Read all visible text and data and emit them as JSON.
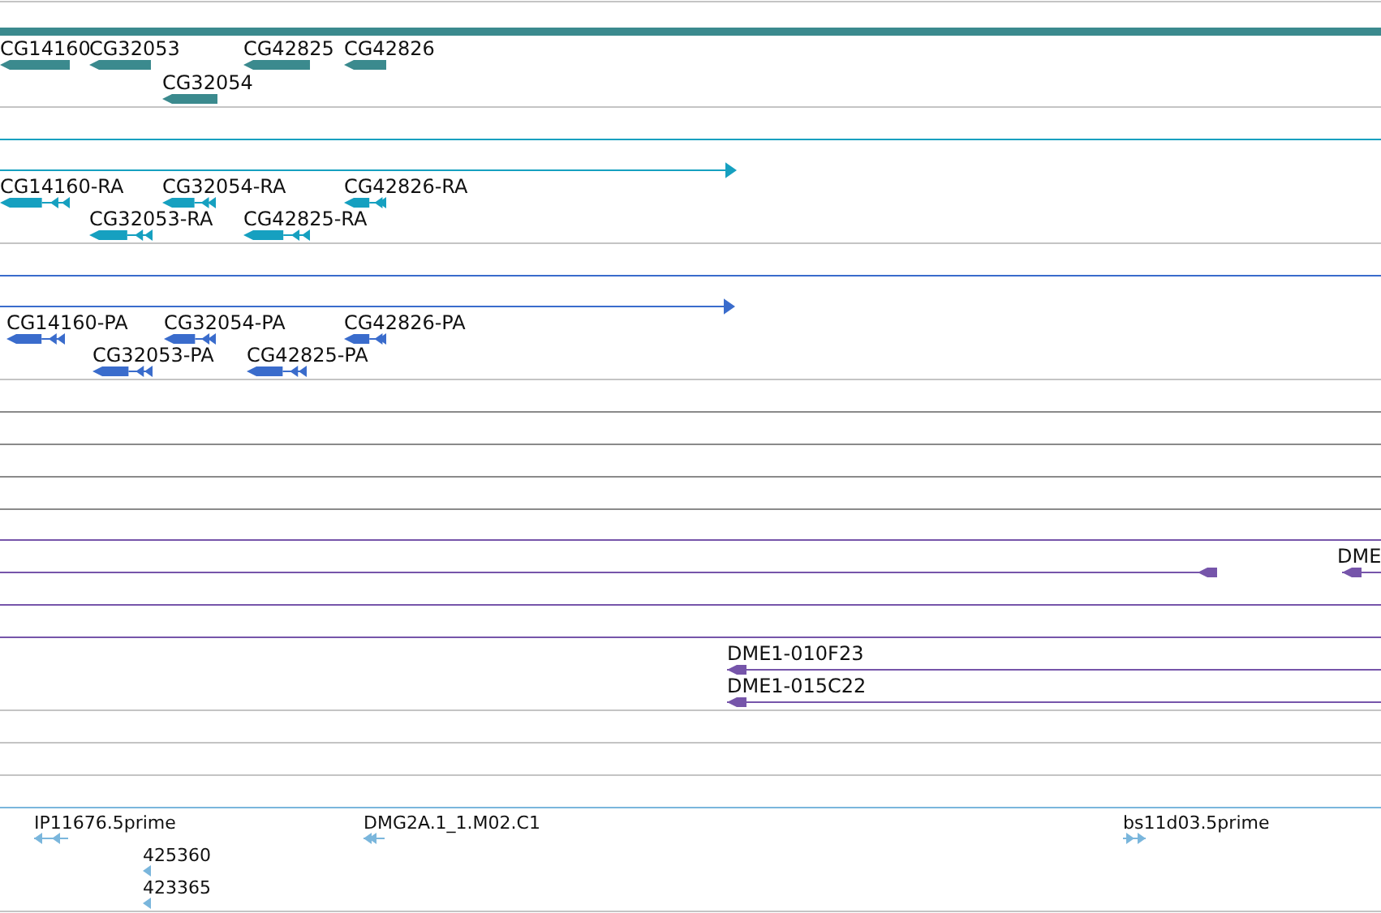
{
  "tracks": [
    {
      "kind": "gene",
      "color": "#3b8a8e",
      "features": [
        {
          "label": "CG14160",
          "reverse": true
        },
        {
          "label": "CG32053",
          "reverse": true
        },
        {
          "label": "CG42825",
          "reverse": true
        },
        {
          "label": "CG42826",
          "reverse": true
        },
        {
          "label": "CG32054",
          "reverse": true
        }
      ]
    },
    {
      "kind": "transcript",
      "color": "#16a0c0",
      "features": [
        {
          "reverse": false
        },
        {
          "label": "CG14160-RA",
          "reverse": true
        },
        {
          "label": "CG32054-RA",
          "reverse": true
        },
        {
          "label": "CG42826-RA",
          "reverse": true
        },
        {
          "label": "CG32053-RA",
          "reverse": true
        },
        {
          "label": "CG42825-RA",
          "reverse": true
        }
      ]
    },
    {
      "kind": "transcript",
      "color": "#3a6ccc",
      "features": [
        {
          "reverse": false
        },
        {
          "label": "CG14160-PA",
          "reverse": true
        },
        {
          "label": "CG32054-PA",
          "reverse": true
        },
        {
          "label": "CG42826-PA",
          "reverse": true
        },
        {
          "label": "CG32053-PA",
          "reverse": true
        },
        {
          "label": "CG42825-PA",
          "reverse": true
        }
      ]
    },
    {
      "kind": "match",
      "color": "#7655aa",
      "features": [
        {
          "reverse": true
        },
        {
          "label": "DME",
          "reverse": true
        },
        {
          "label": "DME1-010F23",
          "reverse": true
        },
        {
          "label": "DME1-015C22",
          "reverse": true
        }
      ]
    },
    {
      "kind": "est",
      "color": "#7ab6dc",
      "features": [
        {
          "label": "IP11676.5prime",
          "reverse": true
        },
        {
          "label": "425360",
          "reverse": true
        },
        {
          "label": "423365",
          "reverse": true
        },
        {
          "label": "DMG2A.1_1.M02.C1",
          "reverse": true
        },
        {
          "label": "bs11d03.5prime",
          "reverse": false
        }
      ]
    }
  ]
}
